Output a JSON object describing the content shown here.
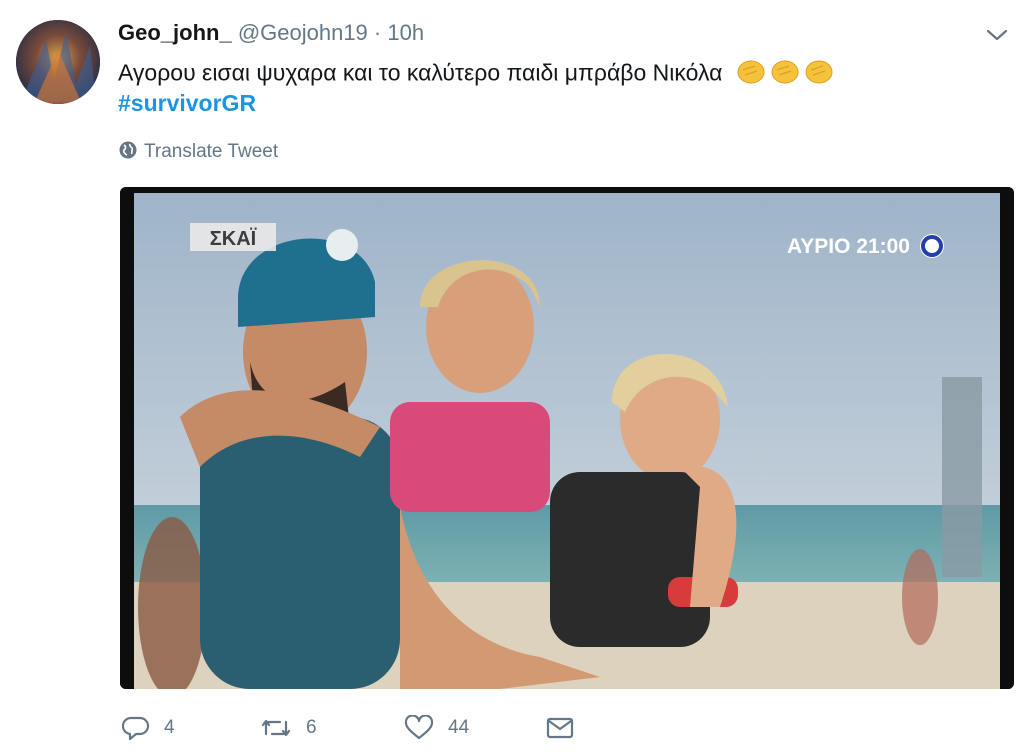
{
  "tweet": {
    "display_name": "Geo_john_",
    "handle": "@Geojohn19",
    "separator": "·",
    "time": "10h",
    "text": "Αγορου εισαι ψυχαρα και το καλύτερο παιδι μπράβο Νικόλα",
    "hashtag": "#survivorGR",
    "translate_label": "Translate Tweet",
    "emoji": "clapping-hands-icon"
  },
  "media": {
    "channel_logo": "ΣΚΑΪ",
    "promo_text": "ΑΥΡΙΟ 21:00"
  },
  "actions": {
    "replies": "4",
    "retweets": "6",
    "likes": "44"
  },
  "colors": {
    "link": "#1b95e0",
    "muted": "#657786",
    "text": "#14171a"
  }
}
